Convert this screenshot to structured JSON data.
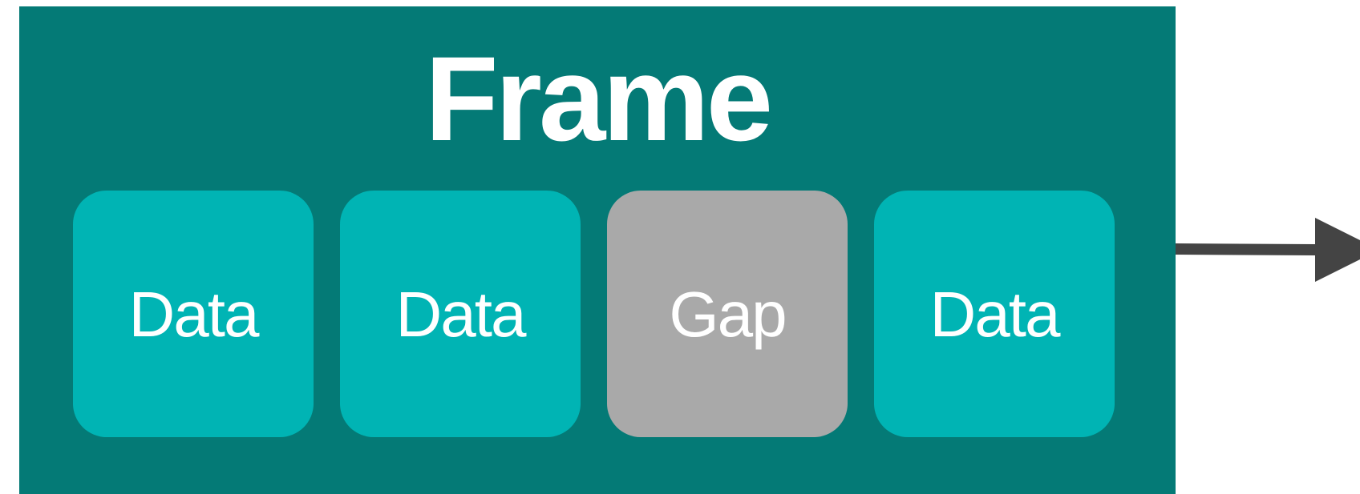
{
  "frame": {
    "title": "Frame",
    "color": "#047A76"
  },
  "blocks": [
    {
      "label": "Data",
      "kind": "data",
      "color": "#00B4B4"
    },
    {
      "label": "Data",
      "kind": "data",
      "color": "#00B4B4"
    },
    {
      "label": "Gap",
      "kind": "gap",
      "color": "#A9A9A9"
    },
    {
      "label": "Data",
      "kind": "data",
      "color": "#00B4B4"
    }
  ],
  "arrow": {
    "color": "#444444",
    "direction": "right"
  }
}
